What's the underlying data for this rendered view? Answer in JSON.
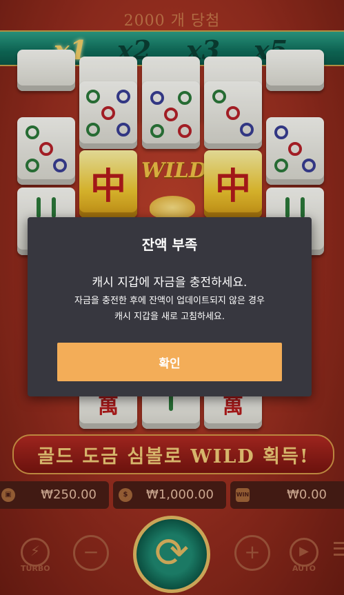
{
  "header": {
    "title": "2000 개 당첨"
  },
  "multipliers": [
    {
      "label": "x1",
      "active": true
    },
    {
      "label": "x2",
      "active": false
    },
    {
      "label": "x3",
      "active": false
    },
    {
      "label": "x5",
      "active": false
    }
  ],
  "reels": {
    "hanzi": "中",
    "wild_label": "WILD",
    "wan": "萬"
  },
  "modal": {
    "title": "잔액 부족",
    "message": "캐시 지갑에 자금을 충전하세요.",
    "detail_line1": "자금을 충전한 후에 잔액이 업데이트되지 않은 경우",
    "detail_line2": "캐시 지갑을 새로 고침하세요.",
    "confirm_label": "확인"
  },
  "banner": {
    "text": "골드 도금 심볼로 WILD 획득!"
  },
  "stats": {
    "balance": "₩250.00",
    "bet": "₩1,000.00",
    "win": "₩0.00",
    "win_icon_label": "WIN"
  },
  "controls": {
    "turbo_label": "TURBO",
    "auto_label": "AUTO",
    "minus": "−",
    "plus": "+"
  },
  "colors": {
    "modal_bg": "#37373f",
    "confirm_btn": "#f3ad58",
    "multiplier_active": "#f6d36a"
  }
}
